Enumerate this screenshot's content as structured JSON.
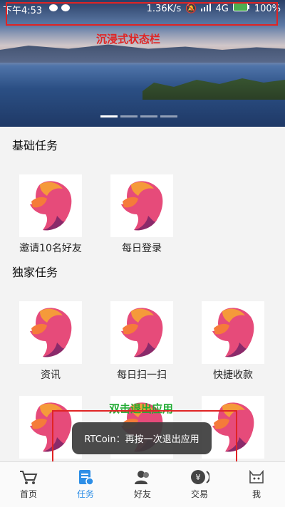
{
  "status_bar": {
    "time": "下午4:53",
    "speed": "1.36K/s",
    "network": "4G",
    "battery": "100%"
  },
  "annotations": {
    "status_label": "沉浸式状态栏",
    "exit_label": "双击退出应用"
  },
  "sections": [
    {
      "title": "基础任务",
      "items": [
        {
          "label": "邀请10名好友"
        },
        {
          "label": "每日登录"
        }
      ]
    },
    {
      "title": "独家任务",
      "items": [
        {
          "label": "资讯"
        },
        {
          "label": "每日扫一扫"
        },
        {
          "label": "快捷收款"
        }
      ]
    }
  ],
  "toast": "RTCoin：再按一次退出应用",
  "tabs": [
    {
      "label": "首页"
    },
    {
      "label": "任务"
    },
    {
      "label": "好友"
    },
    {
      "label": "交易"
    },
    {
      "label": "我"
    }
  ],
  "colors": {
    "accent": "#2d8ee6",
    "annotation": "#e02424",
    "annotation_green": "#22aa33"
  }
}
